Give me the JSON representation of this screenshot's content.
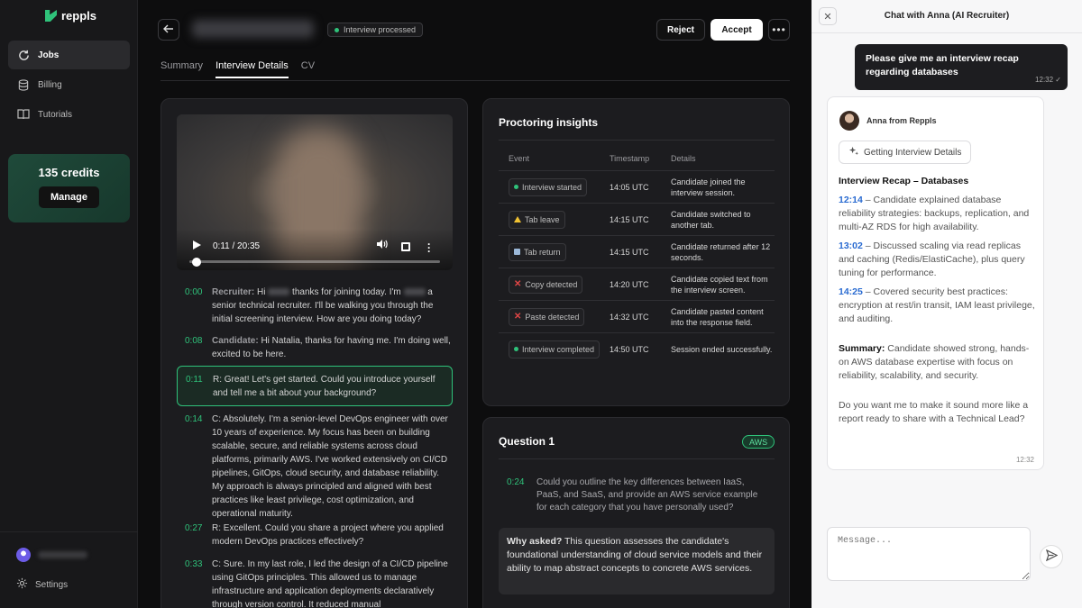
{
  "sidebar": {
    "brand": "reppls",
    "nav": [
      {
        "label": "Jobs",
        "icon": "refresh-icon"
      },
      {
        "label": "Billing",
        "icon": "database-icon"
      },
      {
        "label": "Tutorials",
        "icon": "book-icon"
      }
    ],
    "credits": "135 credits",
    "manage_label": "Manage",
    "settings_label": "Settings"
  },
  "header": {
    "status": "Interview processed",
    "reject_label": "Reject",
    "accept_label": "Accept",
    "more_label": "•••",
    "tabs": [
      "Summary",
      "Interview Details",
      "CV"
    ]
  },
  "video": {
    "time": "0:11 / 20:35",
    "progress": 0.009
  },
  "transcript": [
    {
      "ts": "0:00",
      "speaker": "Recruiter:",
      "pre": "Hi",
      "mid": "thanks for joining today. I'm",
      "text": "a senior technical recruiter. I'll be walking you through the initial screening interview. How are you doing today?"
    },
    {
      "ts": "0:08",
      "speaker": "Candidate:",
      "text": "Hi Natalia, thanks for having me. I'm doing well, excited to be here."
    },
    {
      "ts": "0:11",
      "speaker": "",
      "text": "R: Great! Let's get started. Could you introduce yourself and tell me a bit about your background?"
    },
    {
      "ts": "0:14",
      "speaker": "",
      "text": "C: Absolutely. I'm a senior-level DevOps engineer with over 10 years of experience. My focus has been on building scalable, secure, and reliable systems across cloud platforms, primarily AWS. I've worked extensively on CI/CD pipelines, GitOps, cloud security, and database reliability. My approach is always principled and aligned with best practices like least privilege, cost optimization, and operational maturity."
    },
    {
      "ts": "0:27",
      "speaker": "",
      "text": "R: Excellent. Could you share a project where you applied modern DevOps practices effectively?"
    },
    {
      "ts": "0:33",
      "speaker": "",
      "text": "C: Sure. In my last role, I led the design of a CI/CD pipeline using GitOps principles. This allowed us to manage infrastructure and application deployments declaratively through version control. It reduced manual"
    }
  ],
  "proctoring": {
    "title": "Proctoring insights",
    "columns": [
      "Event",
      "Timestamp",
      "Details"
    ],
    "rows": [
      {
        "event": "Interview started",
        "icon": "green-dot-icon",
        "time": "14:05 UTC",
        "details": "Candidate joined the interview session."
      },
      {
        "event": "Tab leave",
        "icon": "warning-icon",
        "time": "14:15 UTC",
        "details": "Candidate switched to another tab."
      },
      {
        "event": "Tab return",
        "icon": "return-icon",
        "time": "14:15 UTC",
        "details": "Candidate returned after 12 seconds."
      },
      {
        "event": "Copy detected",
        "icon": "x-icon",
        "time": "14:20 UTC",
        "details": "Candidate copied text from the interview screen."
      },
      {
        "event": "Paste detected",
        "icon": "x-icon",
        "time": "14:32 UTC",
        "details": "Candidate pasted content into the response field."
      },
      {
        "event": "Interview completed",
        "icon": "green-dot-icon",
        "time": "14:50 UTC",
        "details": "Session ended successfully."
      }
    ]
  },
  "question": {
    "title": "Question 1",
    "tag": "AWS",
    "ts": "0:24",
    "text": "Could you outline the key differences between IaaS, PaaS, and SaaS, and provide an AWS service example for each category that you have personally used?",
    "why_label": "Why asked?",
    "why_text": "This question assesses the candidate's foundational understanding of cloud service models and their ability to map abstract concepts to concrete AWS services."
  },
  "chat": {
    "title": "Chat with Anna (AI Recruiter)",
    "user_message": "Please give me an interview recap regarding databases",
    "user_time": "12:32 ✓",
    "ai_name": "Anna from Reppls",
    "chip_label": "Getting Interview Details",
    "recap_title": "Interview Recap – Databases",
    "points": [
      {
        "ts": "12:14",
        "text": " – Candidate explained database reliability strategies: backups, replication, and multi-AZ RDS for high availability."
      },
      {
        "ts": "13:02",
        "text": " – Discussed scaling via read replicas and caching (Redis/ElastiCache), plus query tuning for performance."
      },
      {
        "ts": "14:25",
        "text": " – Covered security best practices: encryption at rest/in transit, IAM least privilege, and auditing."
      }
    ],
    "summary_label": "Summary:",
    "summary_text": " Candidate showed strong, hands-on AWS database expertise with focus on reliability, scalability, and security.",
    "followup": "Do you want me to make it sound more like a report ready to share with a Technical Lead?",
    "ai_time": "12:32",
    "input_placeholder": "Message..."
  }
}
